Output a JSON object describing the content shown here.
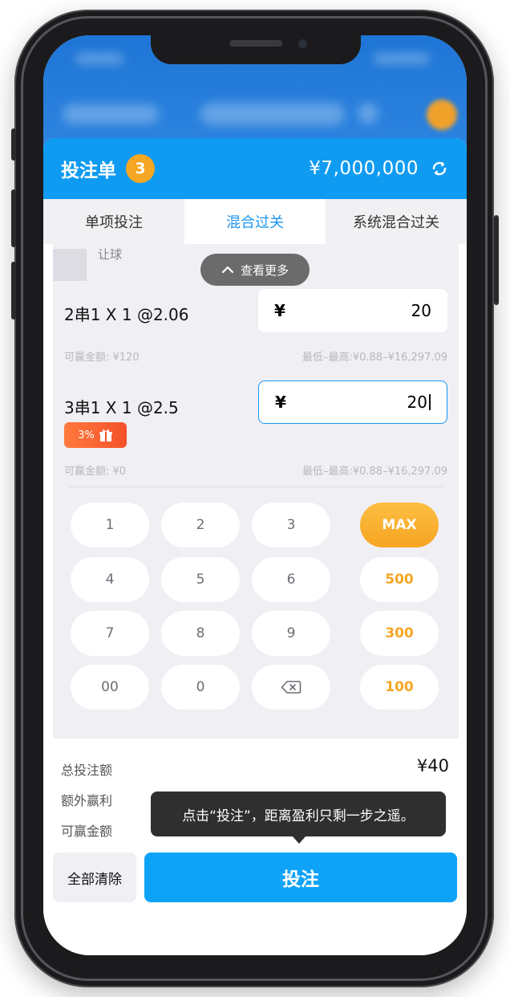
{
  "header": {
    "title": "投注单",
    "count": "3",
    "balance": "¥7,000,000"
  },
  "tabs": [
    {
      "label": "单项投注",
      "active": false
    },
    {
      "label": "混合过关",
      "active": true
    },
    {
      "label": "系统混合过关",
      "active": false
    }
  ],
  "previous_leg": {
    "label": "让球"
  },
  "expand": {
    "label": "查看更多"
  },
  "combos": [
    {
      "label": "2串1 X 1 @2.06",
      "currency": "¥",
      "stake": "20",
      "win_label": "可赢金额: ¥120",
      "limits": "最低–最高:¥0.88–¥16,297.09"
    },
    {
      "label": "3串1 X 1 @2.5",
      "currency": "¥",
      "stake": "20",
      "win_label": "可赢金额: ¥0",
      "limits": "最低–最高:¥0.88–¥16,297.09",
      "promo": "3%"
    }
  ],
  "keypad": {
    "digits": [
      "1",
      "2",
      "3",
      "4",
      "5",
      "6",
      "7",
      "8",
      "9",
      "00",
      "0"
    ],
    "quick": [
      "MAX",
      "500",
      "300",
      "100"
    ]
  },
  "summary": {
    "total_label": "总投注额",
    "total_value": "¥40",
    "extra_label": "额外赢利",
    "win_label": "可赢金额"
  },
  "tooltip": "点击“投注”，距离盈利只剩一步之遥。",
  "buttons": {
    "clear": "全部清除",
    "bet": "投注"
  },
  "colors": {
    "header_blue": "#0f9bf2",
    "accent_orange": "#f5a623",
    "bet_blue": "#0fa3f8"
  }
}
